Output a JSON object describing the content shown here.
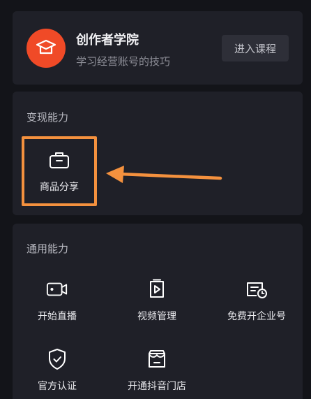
{
  "academy": {
    "title": "创作者学院",
    "subtitle": "学习经营账号的技巧",
    "button_label": "进入课程",
    "logo_icon": "graduation-cap-icon",
    "logo_color": "#f04a27"
  },
  "monetize": {
    "section_title": "变现能力",
    "items": [
      {
        "label": "商品分享",
        "icon": "briefcase-icon"
      }
    ],
    "annotation_color": "#f4913e"
  },
  "general": {
    "section_title": "通用能力",
    "items": [
      {
        "label": "开始直播",
        "icon": "live-camera-icon"
      },
      {
        "label": "视频管理",
        "icon": "video-file-icon"
      },
      {
        "label": "免费开企业号",
        "icon": "enterprise-card-icon"
      },
      {
        "label": "官方认证",
        "icon": "shield-check-icon"
      },
      {
        "label": "开通抖音门店",
        "icon": "store-icon"
      }
    ]
  }
}
